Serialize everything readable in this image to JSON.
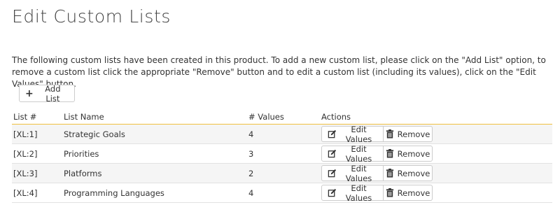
{
  "page": {
    "title": "Edit Custom Lists",
    "intro": "The following custom lists have been created in this product. To add a new custom list, please click on the \"Add List\" option, to remove a custom list click the appropriate \"Remove\" button and to edit a custom list (including its values), click on the \"Edit Values\" button."
  },
  "toolbar": {
    "add_label": "Add List",
    "add_icon": "plus-icon"
  },
  "table": {
    "headers": [
      "List #",
      "List Name",
      "# Values",
      "Actions"
    ],
    "rows": [
      {
        "id": "[XL:1]",
        "name": "Strategic Goals",
        "values": "4"
      },
      {
        "id": "[XL:2]",
        "name": "Priorities",
        "values": "3"
      },
      {
        "id": "[XL:3]",
        "name": "Platforms",
        "values": "2"
      },
      {
        "id": "[XL:4]",
        "name": "Programming Languages",
        "values": "4"
      }
    ],
    "edit_label": "Edit Values",
    "edit_icon": "edit-icon",
    "remove_label": "Remove",
    "remove_icon": "trash-icon"
  },
  "colors": {
    "header_border": "#f0c040",
    "stripe": "#f5f5f5"
  }
}
